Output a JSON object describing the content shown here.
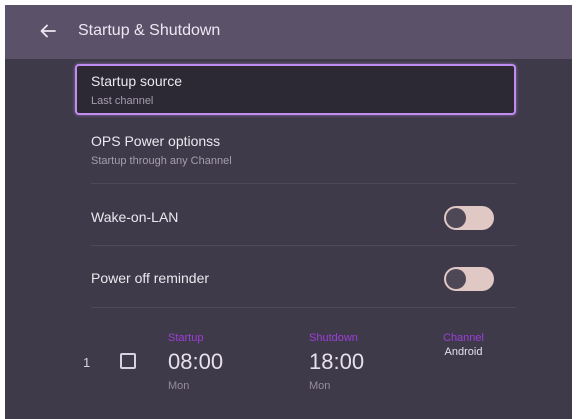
{
  "header": {
    "title": "Startup & Shutdown",
    "back_icon": "arrow-left-icon"
  },
  "settings": {
    "startup_source": {
      "title": "Startup source",
      "value": "Last channel"
    },
    "ops_power": {
      "title": "OPS Power optionss",
      "value": "Startup through any Channel"
    },
    "wake_on_lan": {
      "title": "Wake-on-LAN",
      "enabled": false
    },
    "power_off_reminder": {
      "title": "Power off reminder",
      "enabled": false
    }
  },
  "schedule": {
    "entries": [
      {
        "index": "1",
        "checked": false,
        "startup_label": "Startup",
        "startup_time": "08:00",
        "startup_day": "Mon",
        "shutdown_label": "Shutdown",
        "shutdown_time": "18:00",
        "shutdown_day": "Mon",
        "channel_label": "Channel",
        "channel_value": "Android"
      }
    ]
  },
  "colors": {
    "background": "#3f3a49",
    "header": "#5b526a",
    "focus_border": "#c18cf2",
    "accent_purple": "#9b3fd8",
    "toggle_track": "#e0c8c4"
  }
}
